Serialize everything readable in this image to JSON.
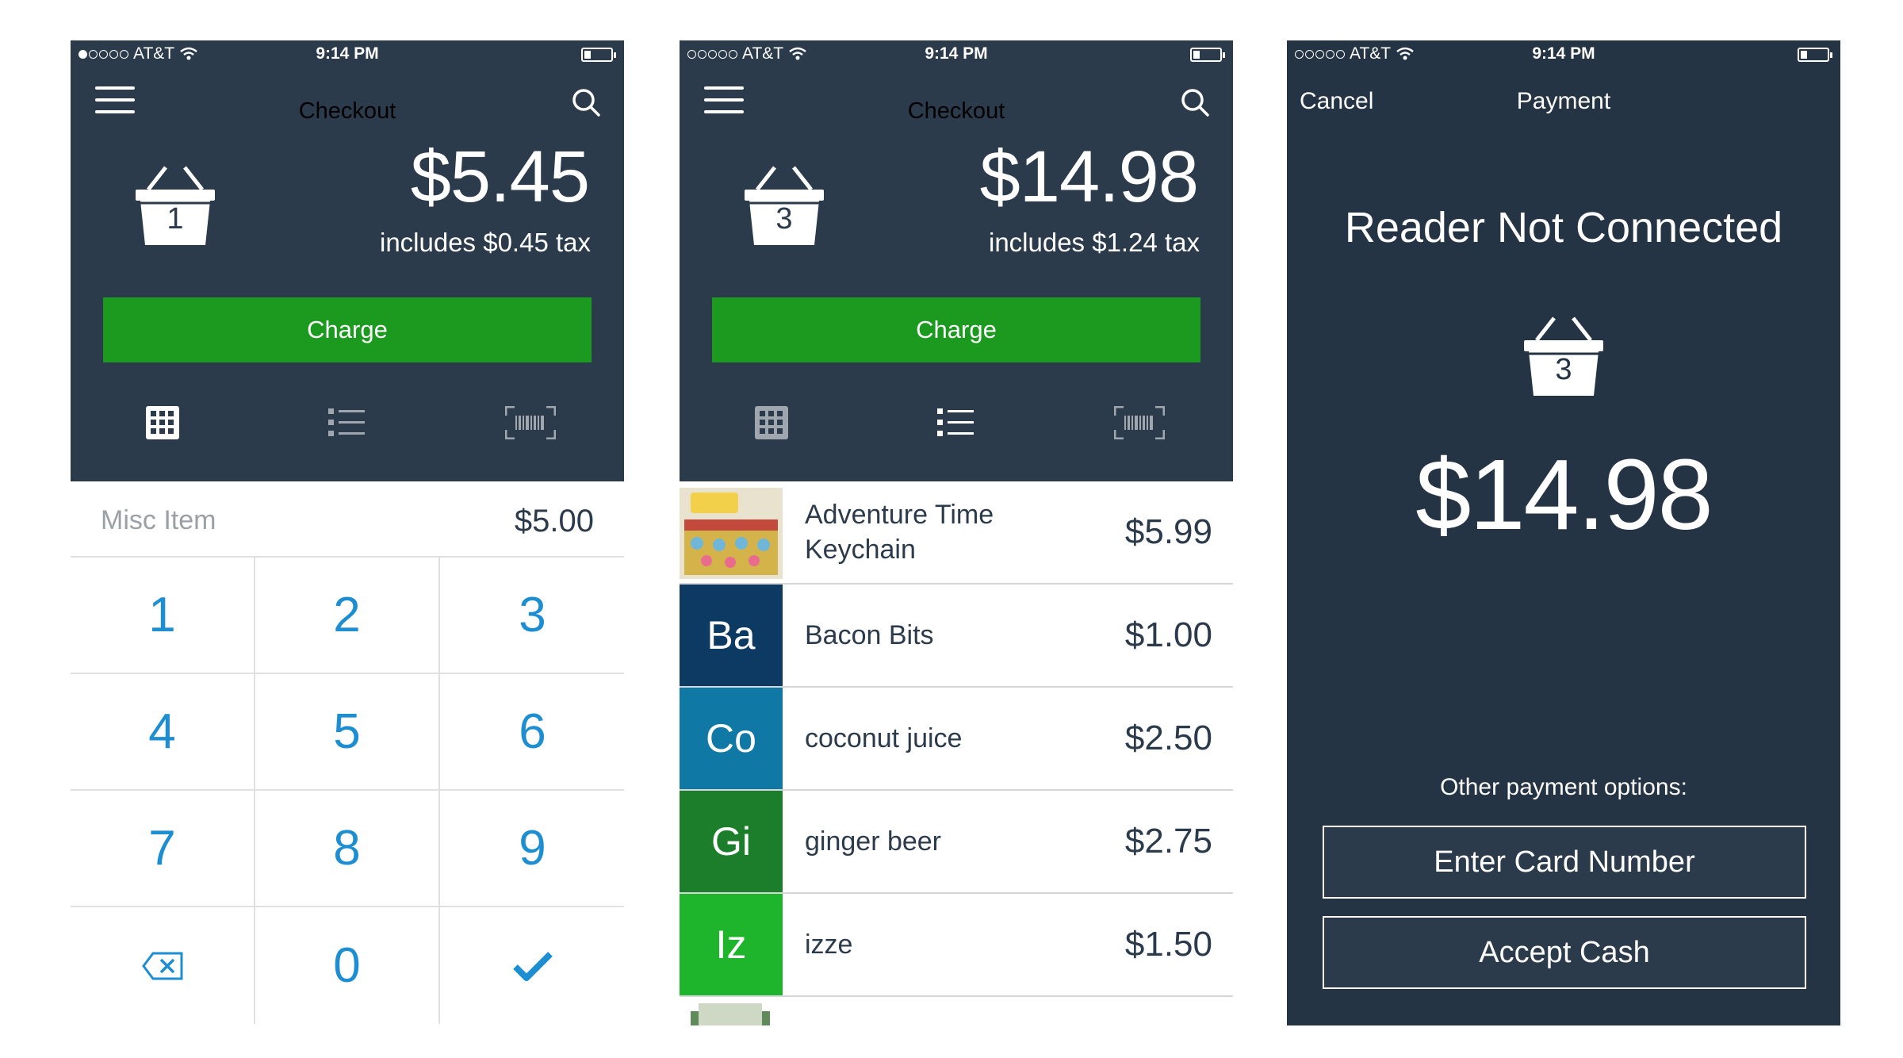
{
  "status_bar": {
    "carrier": "AT&T",
    "time": "9:14 PM"
  },
  "screen1": {
    "title": "Checkout",
    "basket_count": "1",
    "total": "$5.45",
    "tax": "includes $0.45 tax",
    "charge_label": "Charge",
    "misc_label": "Misc Item",
    "misc_value": "$5.00",
    "keys": [
      "1",
      "2",
      "3",
      "4",
      "5",
      "6",
      "7",
      "8",
      "9",
      "0"
    ]
  },
  "screen2": {
    "title": "Checkout",
    "basket_count": "3",
    "total": "$14.98",
    "tax": "includes $1.24 tax",
    "charge_label": "Charge",
    "items": [
      {
        "name": "Adventure Time Keychain",
        "price": "$5.99"
      },
      {
        "tile": "Ba",
        "name": "Bacon Bits",
        "price": "$1.00",
        "color": "#0d3a63"
      },
      {
        "tile": "Co",
        "name": "coconut juice",
        "price": "$2.50",
        "color": "#0f78a4"
      },
      {
        "tile": "Gi",
        "name": "ginger beer",
        "price": "$2.75",
        "color": "#1c7d2a"
      },
      {
        "tile": "Iz",
        "name": "izze",
        "price": "$1.50",
        "color": "#1eb52d"
      }
    ]
  },
  "screen3": {
    "cancel_label": "Cancel",
    "title": "Payment",
    "heading": "Reader Not Connected",
    "basket_count": "3",
    "total": "$14.98",
    "other_label": "Other payment options:",
    "enter_card_label": "Enter Card Number",
    "accept_cash_label": "Accept Cash"
  },
  "colors": {
    "header_bg": "#2b3b4b",
    "charge_green": "#1b9a1f",
    "key_blue": "#1d8ed1"
  }
}
